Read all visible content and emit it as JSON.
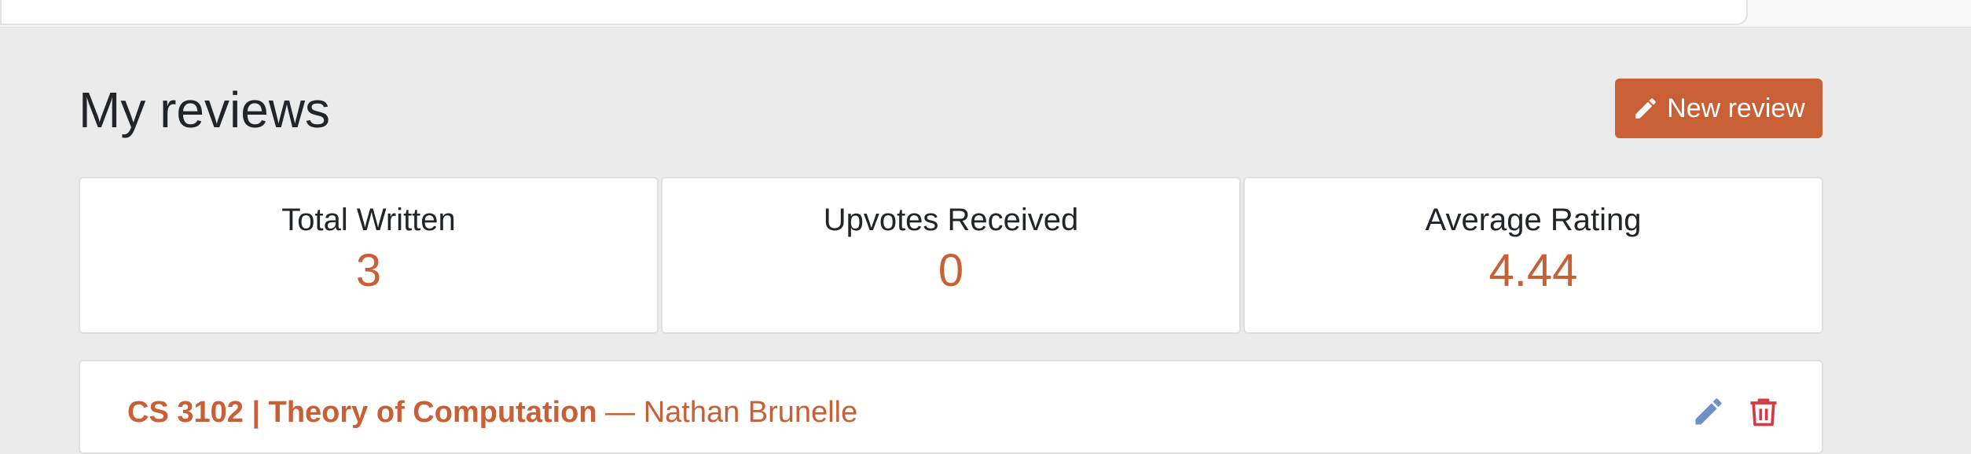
{
  "header": {
    "title": "My reviews",
    "new_review_label": "New review",
    "new_review_icon": "pencil-icon"
  },
  "stats": [
    {
      "label": "Total Written",
      "value": "3"
    },
    {
      "label": "Upvotes Received",
      "value": "0"
    },
    {
      "label": "Average Rating",
      "value": "4.44"
    }
  ],
  "reviews": [
    {
      "course": "CS 3102 | Theory of Computation",
      "instructor": "— Nathan Brunelle",
      "edit_icon": "pencil-icon",
      "delete_icon": "trash-icon"
    }
  ],
  "colors": {
    "accent": "#c95f35",
    "edit": "#6f8fc8",
    "delete": "#d23a45",
    "background": "#ebebeb"
  }
}
